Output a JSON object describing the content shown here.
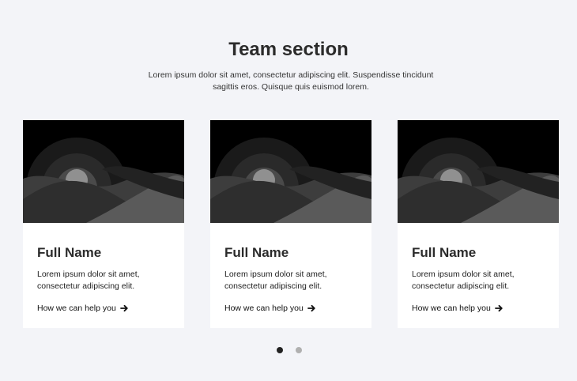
{
  "section": {
    "title": "Team section",
    "subtitle": "Lorem ipsum dolor sit amet, consectetur adipiscing elit. Suspendisse tincidunt sagittis eros. Quisque quis euismod lorem."
  },
  "cards": [
    {
      "name": "Full Name",
      "description": "Lorem ipsum dolor sit amet, consectetur adipiscing elit.",
      "link": "How we can help you",
      "image_icon": "landscape-illustration"
    },
    {
      "name": "Full Name",
      "description": "Lorem ipsum dolor sit amet, consectetur adipiscing elit.",
      "link": "How we can help you",
      "image_icon": "landscape-illustration"
    },
    {
      "name": "Full Name",
      "description": "Lorem ipsum dolor sit amet, consectetur adipiscing elit.",
      "link": "How we can help you",
      "image_icon": "landscape-illustration"
    }
  ],
  "pagination": {
    "pages": 2,
    "active_page": 1
  },
  "colors": {
    "page_background": "#f3f4f8",
    "card_background": "#ffffff",
    "active_dot": "#222222",
    "inactive_dot": "#b0b0b0"
  }
}
